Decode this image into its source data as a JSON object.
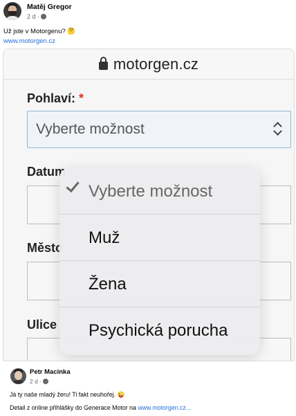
{
  "post": {
    "author": "Matěj Gregor",
    "time": "2 d ·",
    "text": "Už jste v Motorgenu? 🤔",
    "link": "www.motorgen.cz"
  },
  "screenshot": {
    "url": "motorgen.cz",
    "gender_label": "Pohlaví:",
    "required_mark": "*",
    "select_value": "Vyberte možnost",
    "date_label": "Datum",
    "city_label": "Město",
    "street_label": "Ulice",
    "options": [
      "Vyberte možnost",
      "Muž",
      "Žena",
      "Psychická porucha"
    ]
  },
  "comment": {
    "author": "Petr Macinka",
    "time": "2 d ·",
    "text": "Já ty naše mladý žeru! Ti fakt neuhořej. 😜",
    "detail_prefix": "Detail z online přihlášky do Generace Motor na ",
    "detail_link": "www.motorgen.cz..."
  }
}
